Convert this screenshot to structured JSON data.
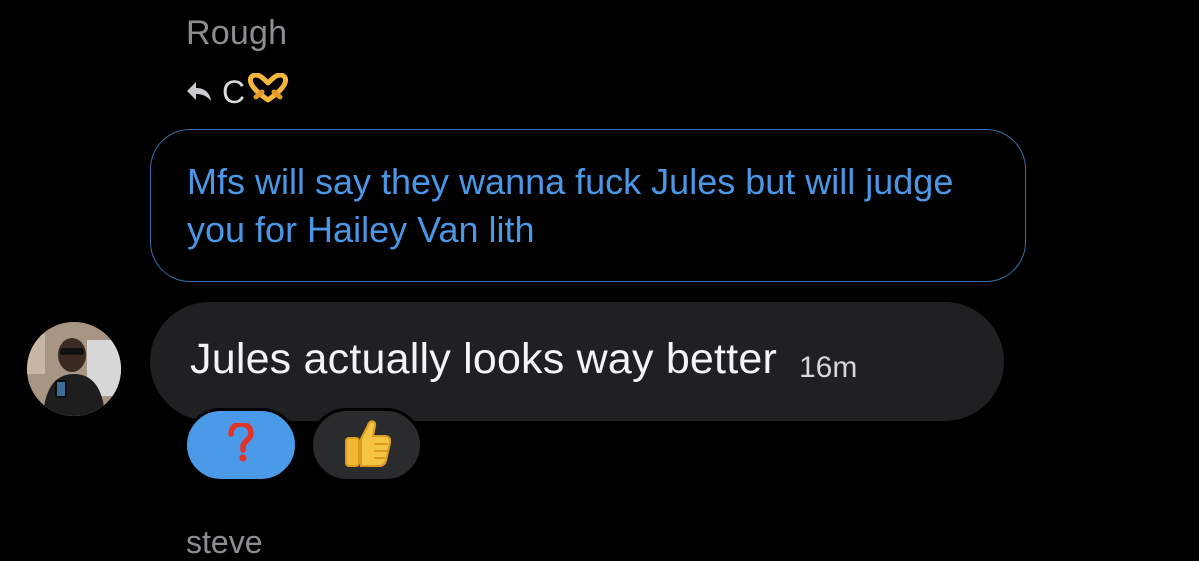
{
  "message_thread": {
    "sender_name": "Rough",
    "reply_context": {
      "target_name": "C",
      "target_emoji_icon": "heart-hands-icon"
    },
    "quoted_message": "Mfs will say they wanna fuck Jules but will judge you for Hailey Van lith",
    "message": {
      "text": "Jules actually looks way better",
      "timestamp": "16m"
    },
    "reactions": [
      {
        "emoji": "question-mark-icon",
        "selected": true
      },
      {
        "emoji": "thumbs-up-icon",
        "selected": false
      }
    ],
    "next_sender_name": "steve"
  },
  "colors": {
    "background": "#000000",
    "quoted_text": "#4a97e6",
    "quoted_border": "#3b6ea5",
    "bubble": "#1f2022",
    "selected_reaction": "#4a9ae8",
    "sender_name": "#8b8d91"
  }
}
